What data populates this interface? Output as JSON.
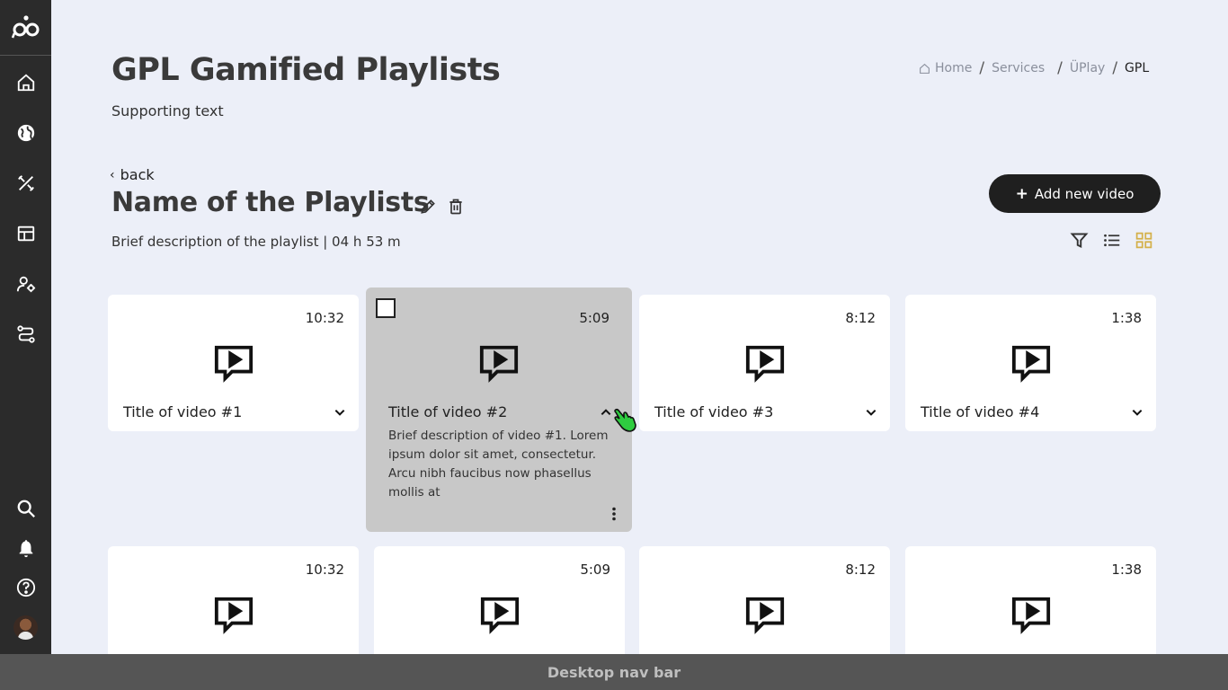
{
  "sidebar": {
    "items": [
      {
        "name": "home-icon"
      },
      {
        "name": "globe-icon"
      },
      {
        "name": "tools-icon"
      },
      {
        "name": "layout-icon"
      },
      {
        "name": "user-settings-icon"
      },
      {
        "name": "route-icon"
      },
      {
        "name": "search-icon"
      },
      {
        "name": "bell-icon"
      },
      {
        "name": "help-icon"
      }
    ]
  },
  "header": {
    "title": "GPL Gamified Playlists",
    "supporting_text": "Supporting text"
  },
  "breadcrumb": {
    "items": [
      "Home",
      "Services",
      "ÜPlay",
      "GPL"
    ],
    "separator": "/"
  },
  "back_label": "back",
  "playlist": {
    "name": "Name of the Playlists",
    "description": "Brief description of the playlist | 04 h 53 m"
  },
  "add_button_label": "Add new video",
  "view_controls": {
    "active": "grid",
    "accent_color": "#d4b04a"
  },
  "videos": [
    {
      "title": "Title of video #1",
      "duration": "10:32"
    },
    {
      "title": "Title of video #2",
      "duration": "5:09",
      "expanded": true,
      "description": "Brief description of video #1. Lorem ipsum dolor sit amet, consectetur. Arcu nibh faucibus now phasellus mollis at"
    },
    {
      "title": "Title of video #3",
      "duration": "8:12"
    },
    {
      "title": "Title of video #4",
      "duration": "1:38"
    },
    {
      "duration": "10:32"
    },
    {
      "duration": "5:09"
    },
    {
      "duration": "8:12"
    },
    {
      "duration": "1:38"
    }
  ],
  "footer_label": "Desktop nav bar"
}
